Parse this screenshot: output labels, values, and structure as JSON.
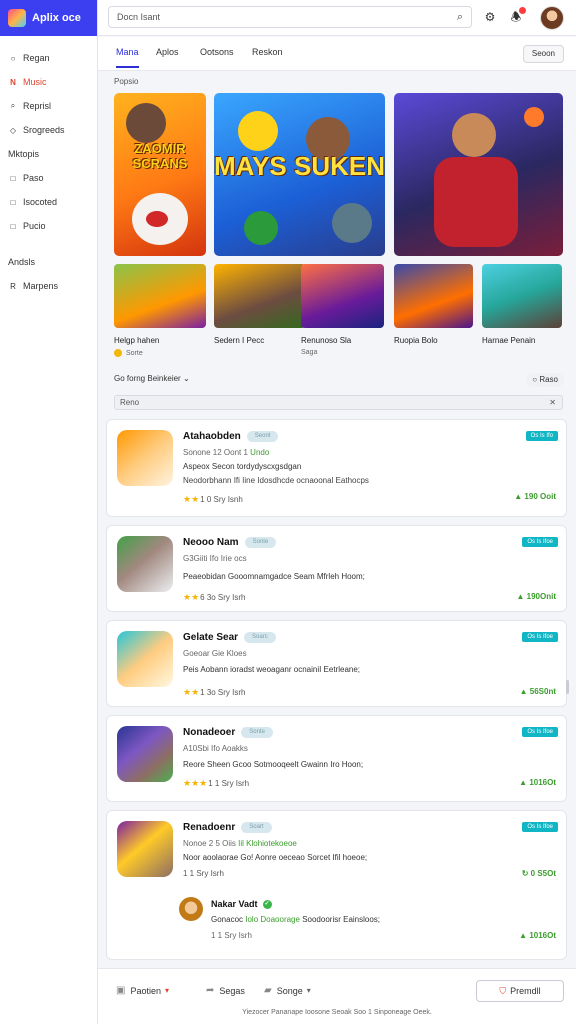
{
  "app": {
    "brand": "Aplix oce"
  },
  "sidebar": {
    "items": [
      {
        "label": "Regan",
        "icon": "circle-icon"
      },
      {
        "label": "Music",
        "icon": "n-icon",
        "active": true
      },
      {
        "label": "Reprisl",
        "icon": "magnifier-icon"
      },
      {
        "label": "Srogreeds",
        "icon": "tag-icon"
      },
      {
        "label": "Mktopis",
        "icon": ""
      },
      {
        "label": "Paso",
        "icon": "square-icon"
      },
      {
        "label": "Isocoted",
        "icon": "square-icon"
      },
      {
        "label": "Pucio",
        "icon": "square-icon"
      }
    ],
    "lower": [
      {
        "label": "Andsls"
      },
      {
        "label": "Marpens"
      }
    ]
  },
  "topbar": {
    "search_value": "Docn Isant"
  },
  "tabs": {
    "items": [
      "Mana",
      "Aplos",
      "Ootsons",
      "Reskon"
    ],
    "button": "Seoon"
  },
  "section_label": "Popsio",
  "featured": [
    {
      "title": "ZAOMIR SCRANS",
      "colors": [
        "#ffb21e",
        "#d3340e"
      ]
    },
    {
      "title": "MAYS SUKEN",
      "colors": [
        "#3aa7ff",
        "#2a3d8c"
      ]
    },
    {
      "title": "",
      "colors": [
        "#5a4ad8",
        "#7a1e3a"
      ]
    }
  ],
  "games": [
    {
      "name": "Helgp hahen",
      "sub": "Sorte"
    },
    {
      "name": "Sedern I Pecc",
      "sub": ""
    },
    {
      "name": "Renunoso Sla",
      "sub": "Saga"
    },
    {
      "name": "Ruopia Bolo",
      "sub": ""
    },
    {
      "name": "Harnae Penain",
      "sub": ""
    }
  ],
  "filter": {
    "label": "Go forng Beinkeier",
    "right": "Raso",
    "search": "Reno"
  },
  "cards": [
    {
      "title": "Atahaobden",
      "pill": "Seont",
      "meta": "Sonone 12 Oont 1 ",
      "meta_green": "Undo",
      "desc1": "Aspeox Secon tordydyscxgsdgan",
      "desc2": "Neodorbhann Ifi Iine Idosdhcde ocnaoonal Eathocps",
      "stars": "1 0 Sry Isnh",
      "tag": "Os Is Ifo",
      "downloads": "190 Ooit"
    },
    {
      "title": "Neooo Nam",
      "pill": "Sonte",
      "meta": "G3Giiti Ifo Irie ocs",
      "meta_green": "",
      "desc1": "Peaeobidan Gooomnamgadce Seam Mfrleh Hoom;",
      "desc2": "",
      "stars": "6 3o Sry Isrh",
      "tag": "Os Is Ifoe",
      "downloads": "190Onit"
    },
    {
      "title": "Gelate Sear",
      "pill": "Soarc",
      "meta": "Goeoar Gie Kloes",
      "meta_green": "",
      "desc1": "Peis Aobann ioradst weoaganr ocnainiI Eetrleane;",
      "desc2": "",
      "stars": "1 3o Sry Isrh",
      "tag": "Os Is Ifoe",
      "downloads": "56S0nt"
    },
    {
      "title": "Nonadeoer",
      "pill": "Sonte",
      "meta": "A10Sbi Ifo Aoakks",
      "meta_green": "",
      "desc1": "Reore Sheen Gcoo Sotmooqeelt Gwainn Iro Hoon;",
      "desc2": "",
      "stars": "1 1 Sry Isrh",
      "tag": "Os Is Ifoe",
      "downloads": "1016Ot"
    },
    {
      "title": "Renadoenr",
      "pill": "Soart",
      "meta": "Nonoe 2 5 Oiis ",
      "meta_green": "Iil Klohiotekoeoe",
      "desc1": "Noor aoolaorae Go! Aonre oeceao Sorcet Ifil hoeoe;",
      "desc2": "",
      "stars": "1 1 Sry Isrh",
      "tag": "Os Is Ifoe",
      "downloads": "0 S5Ot",
      "reply": {
        "name": "Nakar Vadt",
        "text_pre": "Gonacoc ",
        "text_green": "Iolo Doaoorage",
        "text_post": " Soodoorisr Eainsloos;",
        "meta": "1 1 Sry Isrh",
        "downloads": "1016Ot"
      }
    }
  ],
  "bottom": {
    "items": [
      "Paotien",
      "Segas",
      "Songe"
    ],
    "report": "Premdll",
    "footer": "Yiezocer Pananape Ioosone Seoak Soo 1 Sinponeage Oeek."
  }
}
